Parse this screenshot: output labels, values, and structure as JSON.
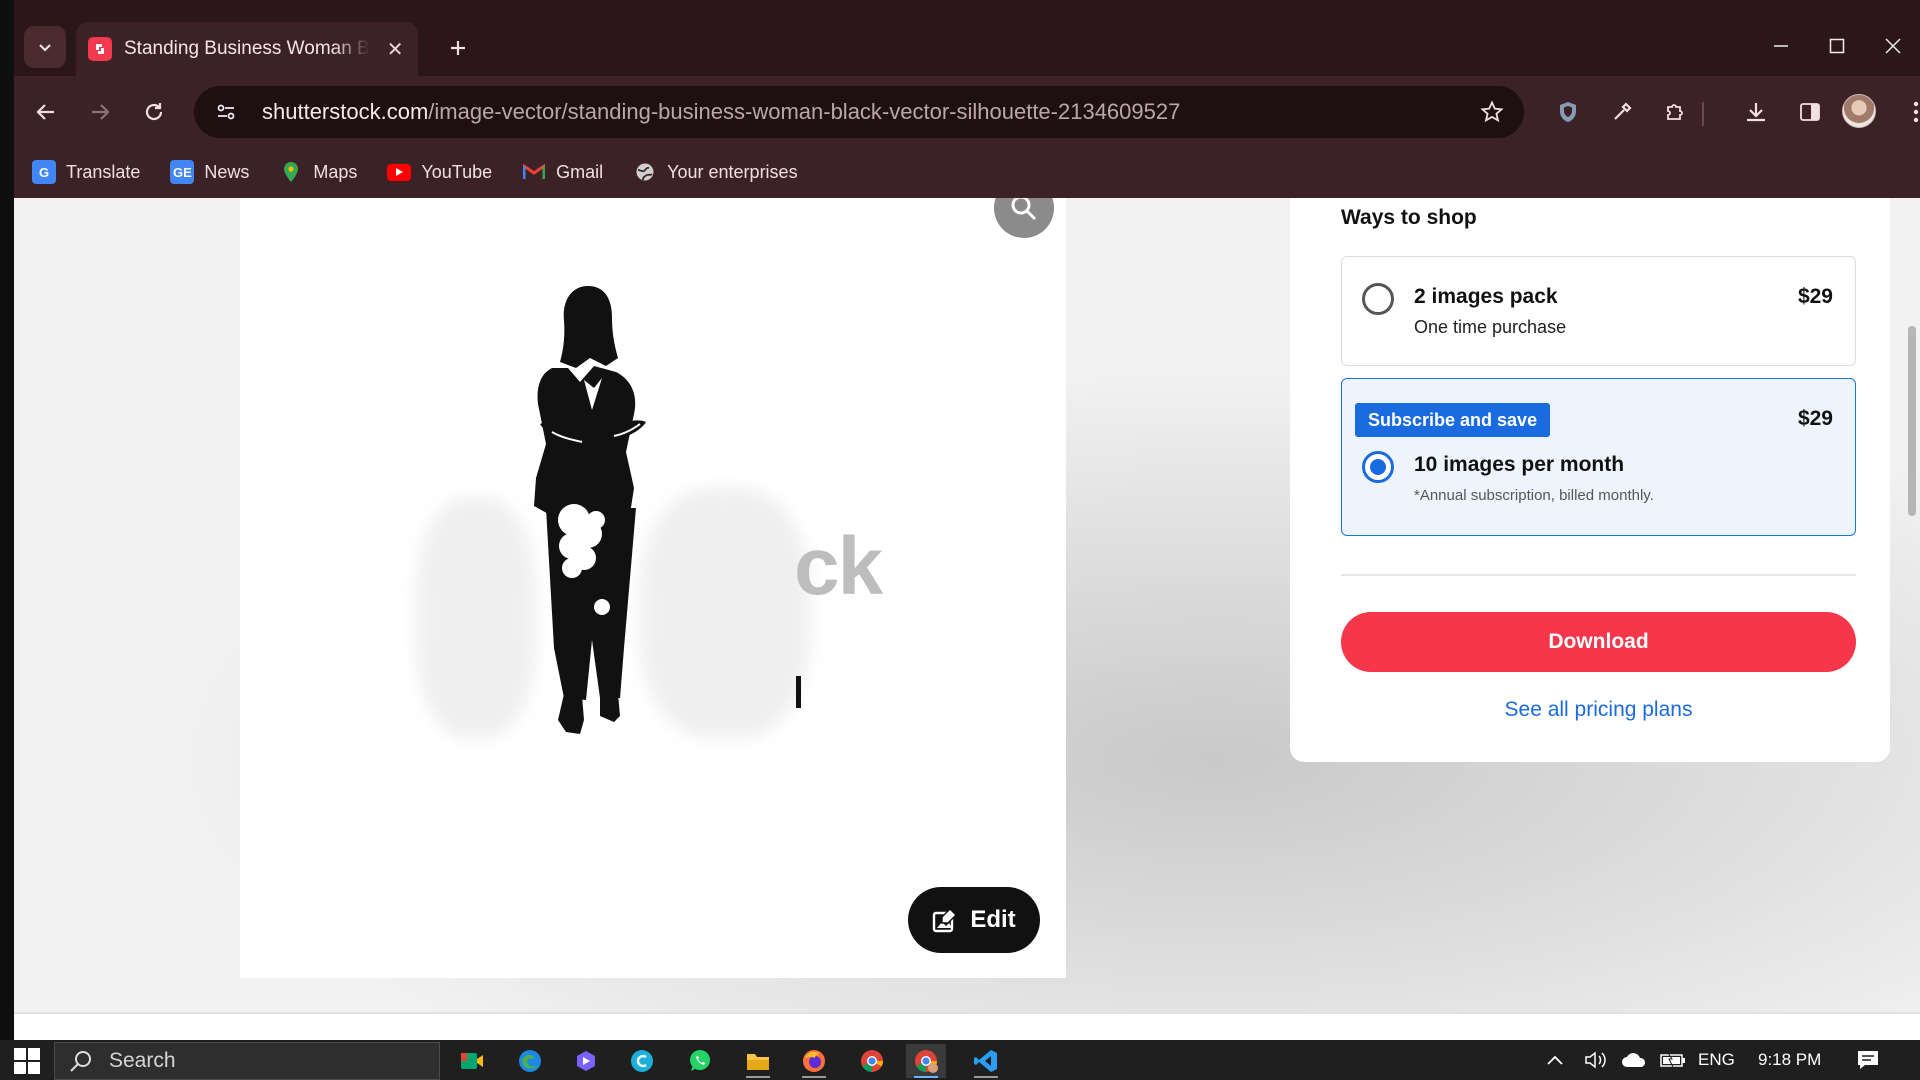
{
  "browser": {
    "tab_title": "Standing Business Woman Black Vector Silhouette",
    "url_host": "shutterstock.com",
    "url_path": "/image-vector/standing-business-woman-black-vector-silhouette-2134609527",
    "bookmarks": [
      {
        "label": "Translate",
        "icon": "translate-icon",
        "color": "#4285f4"
      },
      {
        "label": "News",
        "icon": "news-icon",
        "color": "#4285f4"
      },
      {
        "label": "Maps",
        "icon": "maps-icon",
        "color": "#34a853"
      },
      {
        "label": "YouTube",
        "icon": "youtube-icon",
        "color": "#ff0000"
      },
      {
        "label": "Gmail",
        "icon": "gmail-icon",
        "color": "#ea4335"
      },
      {
        "label": "Your enterprises",
        "icon": "globe-icon",
        "color": "#cccccc"
      }
    ]
  },
  "preview": {
    "watermark_text": "ck",
    "edit_label": "Edit"
  },
  "panel": {
    "title": "Ways to shop",
    "option1": {
      "name": "2 images pack",
      "sub": "One time purchase",
      "price": "$29",
      "selected": false
    },
    "option2": {
      "badge": "Subscribe and save",
      "name": "10 images per month",
      "note": "*Annual subscription, billed monthly.",
      "price": "$29",
      "selected": true
    },
    "download_label": "Download",
    "pricing_link": "See all pricing plans"
  },
  "taskbar": {
    "search_label": "Search",
    "language": "ENG",
    "time": "9:18 PM",
    "apps": [
      "meet-icon",
      "edge-icon",
      "vpn-icon",
      "canva-icon",
      "whatsapp-icon",
      "file-explorer-icon",
      "firefox-icon",
      "chrome-icon",
      "chrome-active-icon",
      "vscode-icon"
    ]
  },
  "colors": {
    "chrome_bg": "#3c2126",
    "accent_blue": "#1a6ae0",
    "download_red": "#f5364b"
  }
}
